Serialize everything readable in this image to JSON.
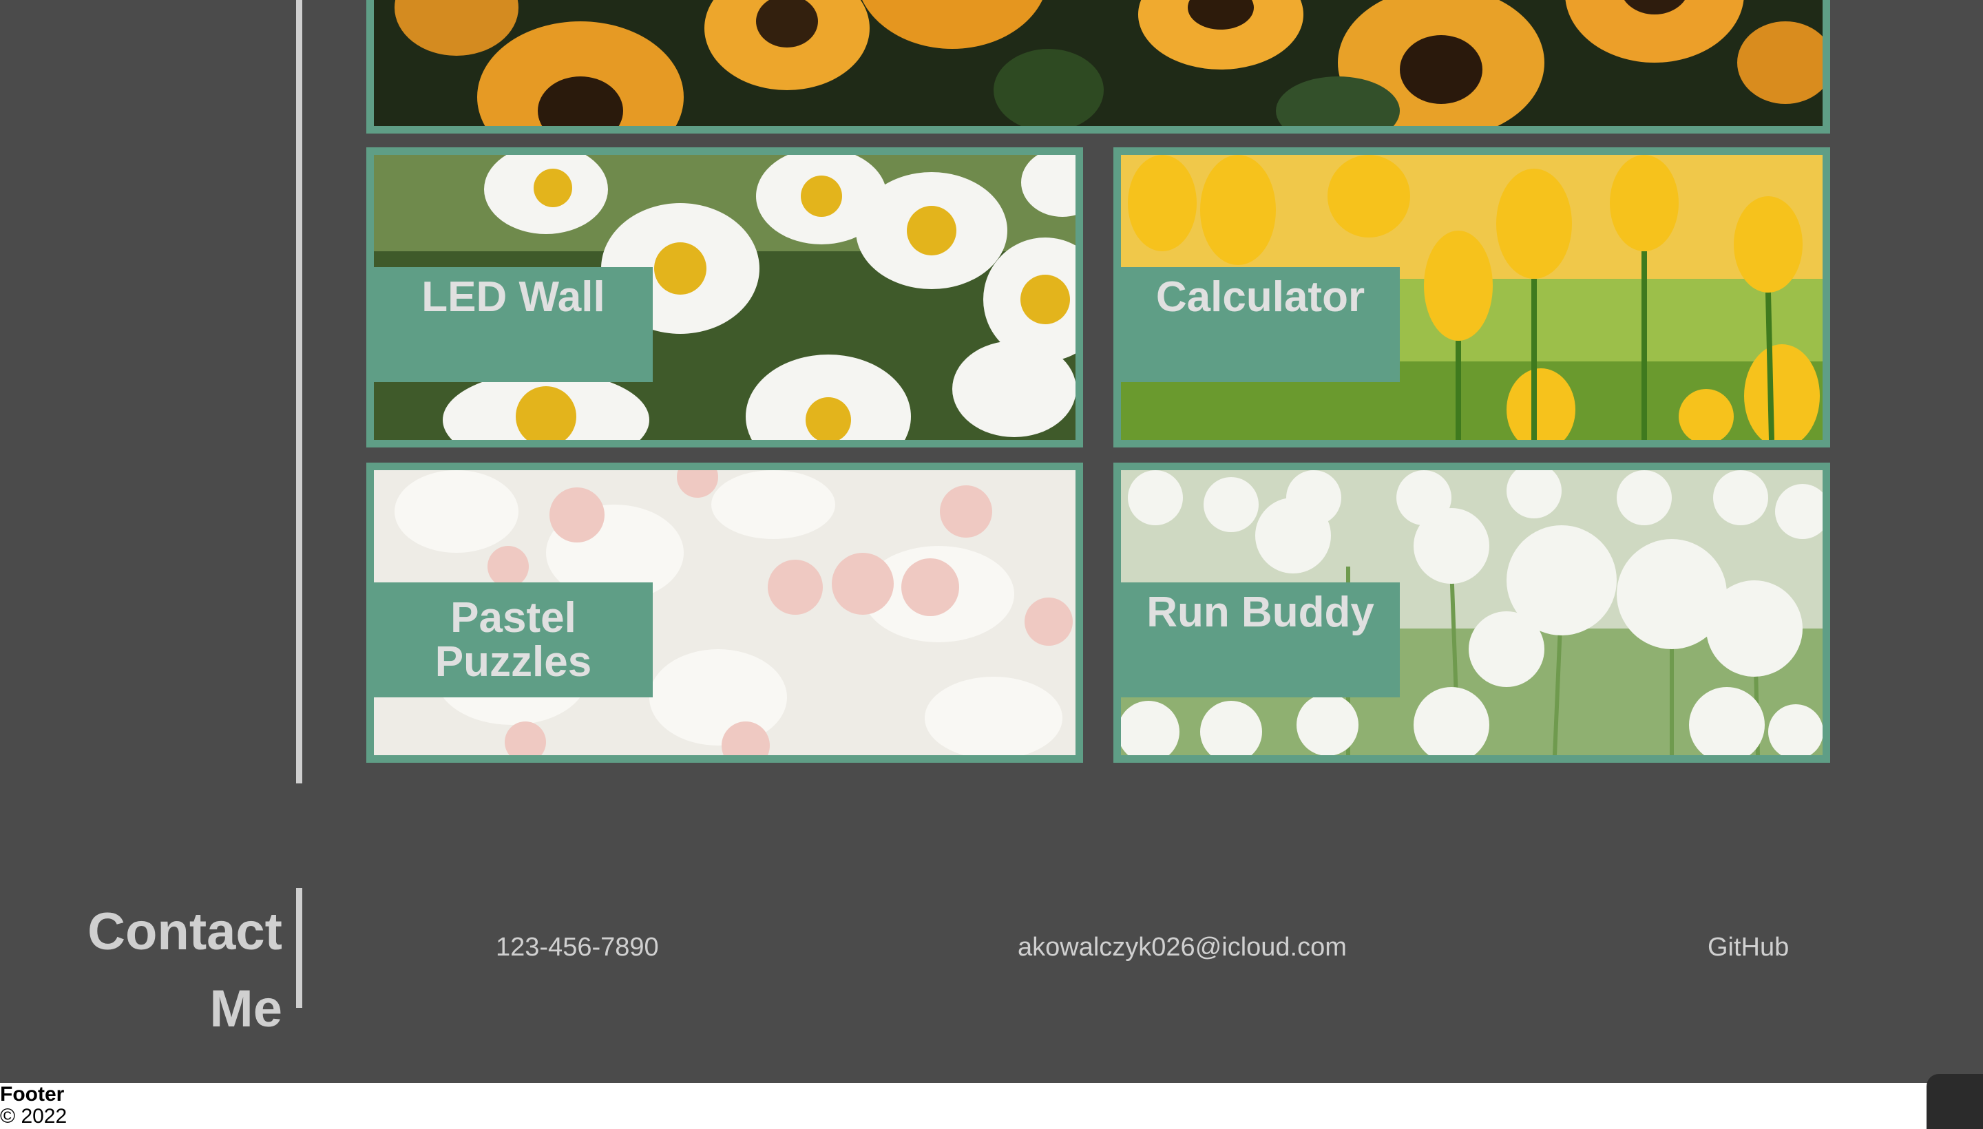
{
  "projects": [
    {
      "title": "LED Wall",
      "image": "daisies"
    },
    {
      "title": "Calculator",
      "image": "yellow-tulips"
    },
    {
      "title": "Pastel Puzzles",
      "image": "white-roses"
    },
    {
      "title": "Run Buddy",
      "image": "white-alliums"
    }
  ],
  "hero": {
    "image": "sunflowers"
  },
  "contact": {
    "heading": "Contact Me",
    "phone": "123-456-7890",
    "email": "akowalczyk026@icloud.com",
    "github": "GitHub"
  },
  "footer": {
    "title": "Footer",
    "copyright": "© 2022"
  },
  "colors": {
    "page_bg": "#4b4b4b",
    "accent": "#5f9e86",
    "text_light": "#d0d0d0"
  }
}
